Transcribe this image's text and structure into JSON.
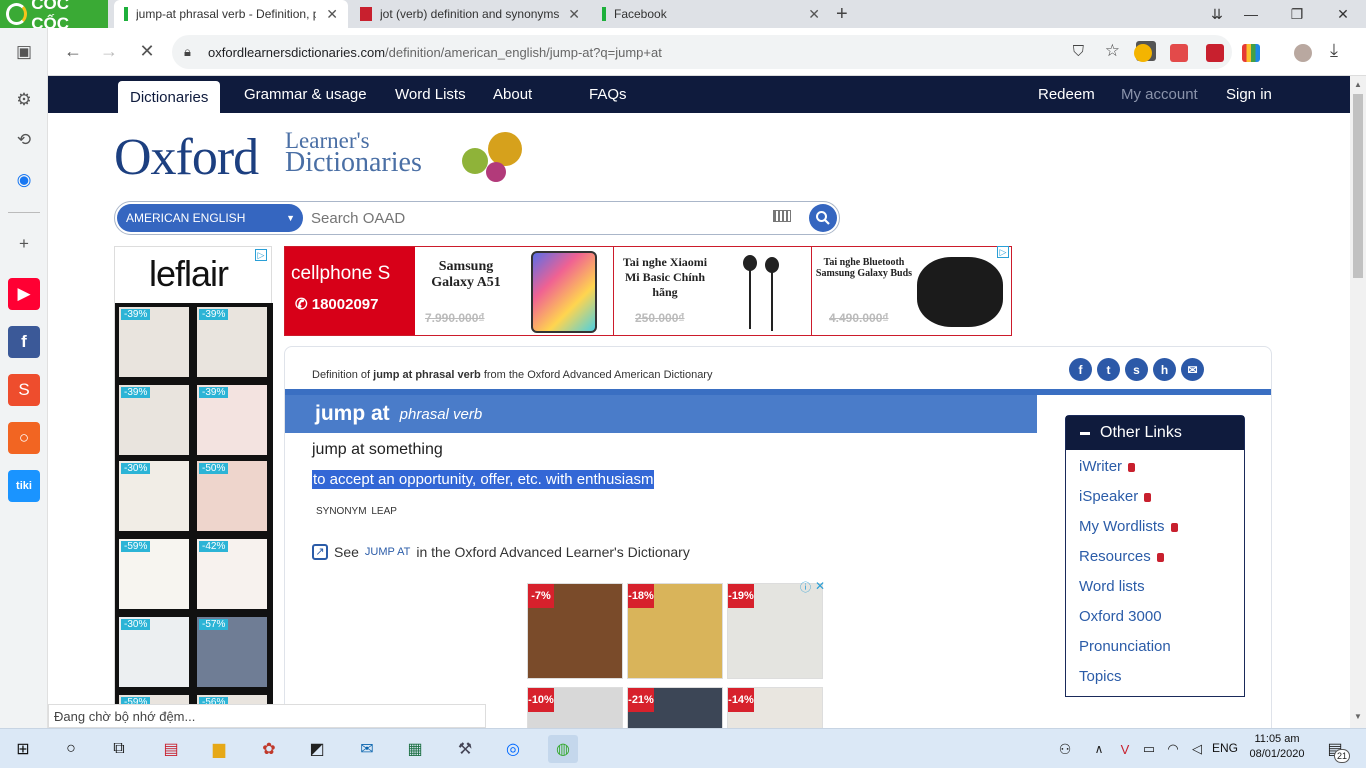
{
  "browser": {
    "brand": "CỐC CỐC",
    "tabs": [
      {
        "title": "jump-at phrasal verb - Definition, p",
        "active": true
      },
      {
        "title": "jot (verb) definition and synonyms",
        "active": false
      },
      {
        "title": "Facebook",
        "active": false
      }
    ],
    "url_domain": "oxfordlearnersdictionaries.com",
    "url_path": "/definition/american_english/jump-at?q=jump+at",
    "status_text": "Đang chờ bộ nhớ đệm..."
  },
  "site": {
    "nav": [
      "Dictionaries",
      "Grammar & usage",
      "Word Lists",
      "About",
      "FAQs"
    ],
    "nav_right": [
      "Redeem",
      "My account",
      "Sign in"
    ],
    "logo_main": "Oxford",
    "logo_line1": "Learner's",
    "logo_line2": "Dictionaries",
    "dict_select": "AMERICAN ENGLISH",
    "search_placeholder": "Search OAAD"
  },
  "ads": {
    "leflair_brand": "leflair",
    "leflair_discounts": [
      "-39%",
      "-39%",
      "-39%",
      "-39%",
      "-30%",
      "-50%",
      "-59%",
      "-42%",
      "-30%",
      "-57%",
      "-59%",
      "-56%"
    ],
    "cellphones_brand": "cellphone S",
    "cellphones_phone": "18002097",
    "banner_items": [
      {
        "name": "Samsung Galaxy A51",
        "old_price": "7.990.000₫"
      },
      {
        "name": "Tai nghe Xiaomi Mi Basic Chính hãng",
        "old_price": "250.000₫"
      },
      {
        "name": "Tai nghe Bluetooth Samsung Galaxy Buds",
        "old_price": "4.490.000₫"
      }
    ],
    "bottom_discounts": [
      "-7%",
      "-18%",
      "-19%",
      "-10%",
      "-21%",
      "-14%"
    ]
  },
  "entry": {
    "definition_prefix": "Definition of",
    "definition_term": "jump at phrasal verb",
    "definition_suffix": "from the Oxford Advanced American Dictionary",
    "headword": "jump at",
    "pos": "phrasal verb",
    "sense_pattern": "jump at something",
    "definition": "to accept an opportunity, offer, etc. with enthusiasm",
    "synonym_label": "SYNONYM",
    "synonym": "LEAP",
    "see_prefix": "See",
    "see_link": "JUMP AT",
    "see_suffix": "in the Oxford Advanced Learner's Dictionary"
  },
  "other_links": {
    "title": "Other Links",
    "items": [
      {
        "label": "iWriter",
        "locked": true
      },
      {
        "label": "iSpeaker",
        "locked": true
      },
      {
        "label": "My Wordlists",
        "locked": true
      },
      {
        "label": "Resources",
        "locked": true
      },
      {
        "label": "Word lists",
        "locked": false
      },
      {
        "label": "Oxford 3000",
        "locked": false
      },
      {
        "label": "Pronunciation",
        "locked": false
      },
      {
        "label": "Topics",
        "locked": false
      }
    ]
  },
  "taskbar": {
    "time": "11:05 am",
    "date": "08/01/2020",
    "lang": "ENG",
    "notifications": "21"
  },
  "colors": {
    "navy": "#0f1b3d",
    "oxford_blue": "#4a7cc9",
    "highlight": "#3367d6",
    "coccoc_green": "#3aaa35"
  }
}
